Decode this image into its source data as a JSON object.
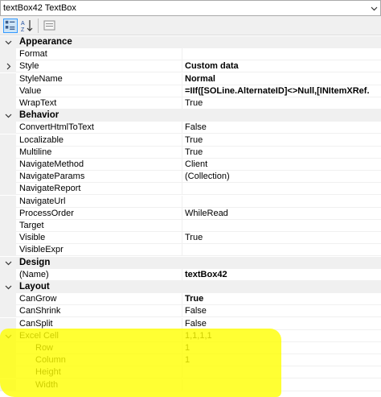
{
  "header": {
    "title": "textBox42 TextBox"
  },
  "toolbar": {
    "categorized_icon": "categorized-icon",
    "alphabetical_icon": "alphabetical-icon",
    "property_pages_icon": "property-pages-icon"
  },
  "grid": {
    "appearance": {
      "label": "Appearance",
      "rows": [
        {
          "name": "Format",
          "value": ""
        },
        {
          "name": "Style",
          "value": "Custom data",
          "bold": true,
          "expandable": true
        },
        {
          "name": "StyleName",
          "value": "Normal",
          "bold": true
        },
        {
          "name": "Value",
          "value": "=IIf([SOLine.AlternateID]<>Null,[INItemXRef.",
          "bold": true
        },
        {
          "name": "WrapText",
          "value": "True"
        }
      ]
    },
    "behavior": {
      "label": "Behavior",
      "rows": [
        {
          "name": "ConvertHtmlToText",
          "value": "False"
        },
        {
          "name": "Localizable",
          "value": "True"
        },
        {
          "name": "Multiline",
          "value": "True"
        },
        {
          "name": "NavigateMethod",
          "value": "Client"
        },
        {
          "name": "NavigateParams",
          "value": "(Collection)"
        },
        {
          "name": "NavigateReport",
          "value": ""
        },
        {
          "name": "NavigateUrl",
          "value": ""
        },
        {
          "name": "ProcessOrder",
          "value": "WhileRead"
        },
        {
          "name": "Target",
          "value": ""
        },
        {
          "name": "Visible",
          "value": "True"
        },
        {
          "name": "VisibleExpr",
          "value": ""
        }
      ]
    },
    "design": {
      "label": "Design",
      "rows": [
        {
          "name": "(Name)",
          "value": "textBox42",
          "bold": true
        }
      ]
    },
    "layout": {
      "label": "Layout",
      "rows": [
        {
          "name": "CanGrow",
          "value": "True",
          "bold": true
        },
        {
          "name": "CanShrink",
          "value": "False"
        },
        {
          "name": "CanSplit",
          "value": "False"
        },
        {
          "name": "Excel Cell",
          "value": "1,1,1,1",
          "expanded": true
        },
        {
          "name": "Row",
          "value": "1",
          "sub": true
        },
        {
          "name": "Column",
          "value": "1",
          "sub": true
        },
        {
          "name": "Height",
          "value": "",
          "sub": true
        },
        {
          "name": "Width",
          "value": "",
          "sub": true
        }
      ]
    }
  },
  "colors": {
    "highlight": "#ffff00",
    "selected_tool": "#cce4f7",
    "category_bg": "#f0f0f0"
  }
}
